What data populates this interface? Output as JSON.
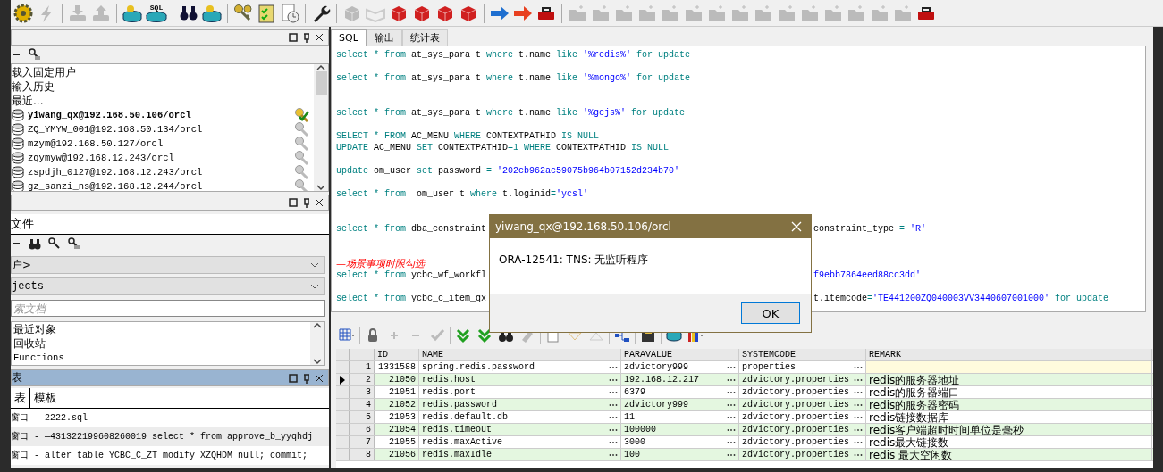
{
  "toolbar": {
    "sql_icon_text": "SQL"
  },
  "connections_panel": {
    "items": [
      {
        "label": "载入固定用户",
        "kind": "action"
      },
      {
        "label": "输入历史",
        "kind": "action"
      },
      {
        "label": "最近...",
        "kind": "action"
      },
      {
        "label": "yiwang_qx@192.168.50.106/orcl",
        "kind": "connection",
        "connected": true
      },
      {
        "label": "ZQ_YMYW_001@192.168.50.134/orcl",
        "kind": "connection",
        "connected": false
      },
      {
        "label": "mzym@192.168.50.127/orcl",
        "kind": "connection",
        "connected": false
      },
      {
        "label": "zqymyw@192.168.12.243/orcl",
        "kind": "connection",
        "connected": false
      },
      {
        "label": "zspdjh_0127@192.168.12.243/orcl",
        "kind": "connection",
        "connected": false
      },
      {
        "label": "gz_sanzi_ns@192.168.12.244/orcl",
        "kind": "connection",
        "connected": false
      }
    ]
  },
  "object_panel": {
    "tab": "文件",
    "user_select": "户>",
    "type_select": "jects",
    "search": {
      "placeholder": "索文档"
    },
    "items": [
      "最近对象",
      "回收站",
      "Functions"
    ]
  },
  "window_panel": {
    "title": "表",
    "tabs": [
      {
        "label": "表",
        "selected": true
      },
      {
        "label": "模板",
        "selected": false
      }
    ],
    "items": [
      "窗口 - 2222.sql",
      "窗口 - —431322199608260019 select * from approve_b_yyqhdj",
      "窗口 - alter table YCBC_C_ZT modify XZQHDM null; commit;"
    ]
  },
  "editor": {
    "tabs": [
      {
        "label": "SQL",
        "selected": true
      },
      {
        "label": "输出",
        "selected": false
      },
      {
        "label": "统计表",
        "selected": false
      }
    ],
    "lines": [
      {
        "kind": "code",
        "tokens": [
          {
            "kind": "keyword",
            "text": "select * from"
          },
          {
            "kind": "plain",
            "text": " at_sys_para t "
          },
          {
            "kind": "keyword",
            "text": "where"
          },
          {
            "kind": "plain",
            "text": " t.name "
          },
          {
            "kind": "keyword",
            "text": "like"
          },
          {
            "kind": "string",
            "text": " '%redis%'"
          },
          {
            "kind": "keyword",
            "text": " for update"
          }
        ]
      },
      {
        "kind": "blank"
      },
      {
        "kind": "code",
        "tokens": [
          {
            "kind": "keyword",
            "text": "select * from"
          },
          {
            "kind": "plain",
            "text": " at_sys_para t "
          },
          {
            "kind": "keyword",
            "text": "where"
          },
          {
            "kind": "plain",
            "text": " t.name "
          },
          {
            "kind": "keyword",
            "text": "like"
          },
          {
            "kind": "string",
            "text": " '%mongo%'"
          },
          {
            "kind": "keyword",
            "text": " for update"
          }
        ]
      },
      {
        "kind": "blank"
      },
      {
        "kind": "blank"
      },
      {
        "kind": "code",
        "tokens": [
          {
            "kind": "keyword",
            "text": "select * from"
          },
          {
            "kind": "plain",
            "text": " at_sys_para t "
          },
          {
            "kind": "keyword",
            "text": "where"
          },
          {
            "kind": "plain",
            "text": " t.name "
          },
          {
            "kind": "keyword",
            "text": "like"
          },
          {
            "kind": "string",
            "text": " '%gcjs%'"
          },
          {
            "kind": "keyword",
            "text": " for update"
          }
        ]
      },
      {
        "kind": "blank"
      },
      {
        "kind": "code",
        "tokens": [
          {
            "kind": "keyword",
            "text": "SELECT * FROM"
          },
          {
            "kind": "plain",
            "text": " AC_MENU "
          },
          {
            "kind": "keyword",
            "text": "WHERE"
          },
          {
            "kind": "plain",
            "text": " CONTEXTPATHID "
          },
          {
            "kind": "keyword",
            "text": "IS NULL"
          }
        ]
      },
      {
        "kind": "code",
        "tokens": [
          {
            "kind": "keyword",
            "text": "UPDATE"
          },
          {
            "kind": "plain",
            "text": " AC_MENU "
          },
          {
            "kind": "keyword",
            "text": "SET"
          },
          {
            "kind": "plain",
            "text": " CONTEXTPATHID"
          },
          {
            "kind": "keyword",
            "text": "=1 WHERE"
          },
          {
            "kind": "plain",
            "text": " CONTEXTPATHID "
          },
          {
            "kind": "keyword",
            "text": "IS NULL"
          }
        ]
      },
      {
        "kind": "blank"
      },
      {
        "kind": "code",
        "tokens": [
          {
            "kind": "keyword",
            "text": "update"
          },
          {
            "kind": "plain",
            "text": " om_user "
          },
          {
            "kind": "keyword",
            "text": "set"
          },
          {
            "kind": "plain",
            "text": " password "
          },
          {
            "kind": "keyword",
            "text": "= "
          },
          {
            "kind": "string",
            "text": "'202cb962ac59075b964b07152d234b70'"
          }
        ]
      },
      {
        "kind": "blank"
      },
      {
        "kind": "code",
        "tokens": [
          {
            "kind": "keyword",
            "text": "select * from"
          },
          {
            "kind": "plain",
            "text": "  om_user t "
          },
          {
            "kind": "keyword",
            "text": "where"
          },
          {
            "kind": "plain",
            "text": " t.loginid"
          },
          {
            "kind": "keyword",
            "text": "="
          },
          {
            "kind": "string",
            "text": "'ycsl'"
          }
        ]
      },
      {
        "kind": "blank"
      },
      {
        "kind": "blank"
      },
      {
        "kind": "split",
        "tokens": [
          {
            "kind": "keyword",
            "text": "select * from"
          },
          {
            "kind": "plain",
            "text": " dba_constraint"
          }
        ],
        "rest": [
          {
            "kind": "plain",
            "text": "constraint_type "
          },
          {
            "kind": "keyword",
            "text": "= "
          },
          {
            "kind": "string",
            "text": "'R'"
          }
        ]
      },
      {
        "kind": "blank"
      },
      {
        "kind": "blank"
      },
      {
        "kind": "comment",
        "text": "—场景事项时限勾选"
      },
      {
        "kind": "split",
        "tokens": [
          {
            "kind": "keyword",
            "text": "select * from"
          },
          {
            "kind": "plain",
            "text": " ycbc_wf_workfl"
          }
        ],
        "rest": [
          {
            "kind": "string",
            "text": "f9ebb7864eed88cc3dd'"
          }
        ]
      },
      {
        "kind": "blank"
      },
      {
        "kind": "split",
        "tokens": [
          {
            "kind": "keyword",
            "text": "select * from"
          },
          {
            "kind": "plain",
            "text": " ycbc_c_item_qx"
          }
        ],
        "rest": [
          {
            "kind": "plain",
            "text": "t.itemcode"
          },
          {
            "kind": "keyword",
            "text": "="
          },
          {
            "kind": "string",
            "text": "'TE441200ZQ040003VV3440607001000'"
          },
          {
            "kind": "keyword",
            "text": " for update"
          }
        ]
      }
    ]
  },
  "grid": {
    "columns": [
      "ID",
      "NAME",
      "PARAVALUE",
      "SYSTEMCODE",
      "REMARK"
    ],
    "rows": [
      {
        "num": "1",
        "current": false,
        "id": "1331588",
        "name": "spring.redis.password",
        "paravalue": "zdvictory999",
        "systemcode": "properties"
      },
      {
        "num": "2",
        "current": true,
        "id": "21050",
        "name": "redis.host",
        "paravalue": "192.168.12.217",
        "systemcode": "zdvictory.properties",
        "remark": "redis的服务器地址"
      },
      {
        "num": "3",
        "current": false,
        "id": "21051",
        "name": "redis.port",
        "paravalue": "6379",
        "systemcode": "zdvictory.properties",
        "remark": "redis的服务器端口"
      },
      {
        "num": "4",
        "current": false,
        "id": "21052",
        "name": "redis.password",
        "paravalue": "zdvictory999",
        "systemcode": "zdvictory.properties",
        "remark": "redis的服务器密码"
      },
      {
        "num": "5",
        "current": false,
        "id": "21053",
        "name": "redis.default.db",
        "paravalue": "11",
        "systemcode": "zdvictory.properties",
        "remark": "redis链接数据库"
      },
      {
        "num": "6",
        "current": false,
        "id": "21054",
        "name": "redis.timeout",
        "paravalue": "100000",
        "systemcode": "zdvictory.properties",
        "remark": "redis客户端超时时间单位是毫秒"
      },
      {
        "num": "7",
        "current": false,
        "id": "21055",
        "name": "redis.maxActive",
        "paravalue": "3000",
        "systemcode": "zdvictory.properties",
        "remark": "redis最大链接数"
      },
      {
        "num": "8",
        "current": false,
        "id": "21056",
        "name": "redis.maxIdle",
        "paravalue": "100",
        "systemcode": "zdvictory.properties",
        "remark": "redis 最大空闲数"
      }
    ]
  },
  "dialog": {
    "title": "yiwang_qx@192.168.50.106/orcl",
    "message": "ORA-12541: TNS: 无监听程序",
    "button": "OK"
  }
}
